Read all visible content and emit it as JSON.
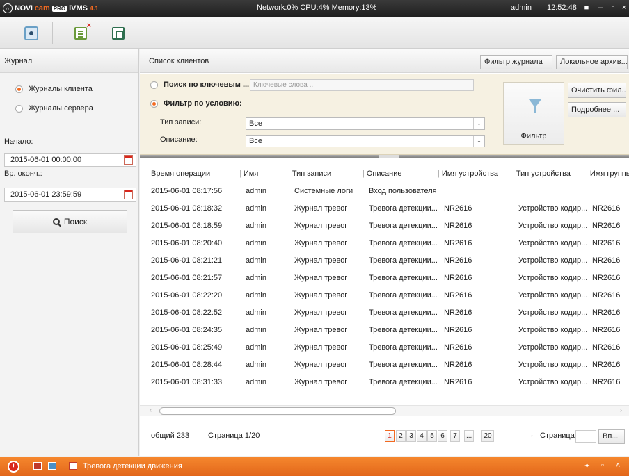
{
  "titlebar": {
    "logo_text_1": "NOVI",
    "logo_text_2": "cam",
    "logo_pro": "PRO",
    "logo_vms": "iVMS",
    "logo_ver": "4.1",
    "sysinfo": "Network:0% CPU:4% Memory:13%",
    "user": "admin",
    "clock": "12:52:48"
  },
  "left": {
    "header": "Журнал",
    "radio_client": "Журналы клиента",
    "radio_server": "Журналы сервера",
    "start_label": "Начало:",
    "start_value": "2015-06-01 00:00:00",
    "end_label": "Вр. оконч.:",
    "end_value": "2015-06-01 23:59:59",
    "search_label": "Поиск"
  },
  "main": {
    "title": "Список клиентов",
    "filter_log_btn": "Фильтр журнала",
    "local_archive_btn": "Локальное архив..."
  },
  "filter": {
    "keyword_radio": "Поиск по ключевым ...",
    "keyword_placeholder": "Ключевые слова ...",
    "condition_radio": "Фильтр по условию:",
    "record_type_label": "Тип записи:",
    "record_type_value": "Все",
    "description_label": "Описание:",
    "description_value": "Все",
    "filter_btn": "Фильтр",
    "clear_btn": "Очистить фил...",
    "more_btn": "Подробнее ..."
  },
  "table": {
    "columns": [
      "Время операции",
      "Имя",
      "Тип записи",
      "Описание",
      "Имя устройства",
      "Тип устройства",
      "Имя группы"
    ],
    "rows": [
      [
        "2015-06-01 08:17:56",
        "admin",
        "Системные логи",
        "Вход пользователя",
        "",
        "",
        ""
      ],
      [
        "2015-06-01 08:18:32",
        "admin",
        "Журнал тревог",
        "Тревога детекции...",
        "NR2616",
        "Устройство кодир...",
        "NR2616"
      ],
      [
        "2015-06-01 08:18:59",
        "admin",
        "Журнал тревог",
        "Тревога детекции...",
        "NR2616",
        "Устройство кодир...",
        "NR2616"
      ],
      [
        "2015-06-01 08:20:40",
        "admin",
        "Журнал тревог",
        "Тревога детекции...",
        "NR2616",
        "Устройство кодир...",
        "NR2616"
      ],
      [
        "2015-06-01 08:21:21",
        "admin",
        "Журнал тревог",
        "Тревога детекции...",
        "NR2616",
        "Устройство кодир...",
        "NR2616"
      ],
      [
        "2015-06-01 08:21:57",
        "admin",
        "Журнал тревог",
        "Тревога детекции...",
        "NR2616",
        "Устройство кодир...",
        "NR2616"
      ],
      [
        "2015-06-01 08:22:20",
        "admin",
        "Журнал тревог",
        "Тревога детекции...",
        "NR2616",
        "Устройство кодир...",
        "NR2616"
      ],
      [
        "2015-06-01 08:22:52",
        "admin",
        "Журнал тревог",
        "Тревога детекции...",
        "NR2616",
        "Устройство кодир...",
        "NR2616"
      ],
      [
        "2015-06-01 08:24:35",
        "admin",
        "Журнал тревог",
        "Тревога детекции...",
        "NR2616",
        "Устройство кодир...",
        "NR2616"
      ],
      [
        "2015-06-01 08:25:49",
        "admin",
        "Журнал тревог",
        "Тревога детекции...",
        "NR2616",
        "Устройство кодир...",
        "NR2616"
      ],
      [
        "2015-06-01 08:28:44",
        "admin",
        "Журнал тревог",
        "Тревога детекции...",
        "NR2616",
        "Устройство кодир...",
        "NR2616"
      ],
      [
        "2015-06-01 08:31:33",
        "admin",
        "Журнал тревог",
        "Тревога детекции...",
        "NR2616",
        "Устройство кодир...",
        "NR2616"
      ]
    ]
  },
  "pager": {
    "total": "общий 233",
    "page_info": "Страница 1/20",
    "pages": [
      "1",
      "2",
      "3",
      "4",
      "5",
      "6",
      "7",
      "...",
      "20"
    ],
    "current_page": "1",
    "goto_label": "Страница",
    "goto_btn": "Вп..."
  },
  "statusbar": {
    "alarm_text": "Тревога детекции движения"
  },
  "colors": {
    "accent": "#f26a21",
    "statusbar": "#f0781f",
    "titlebar": "#2a2a2a",
    "filter_bg": "#f6f1e2"
  }
}
